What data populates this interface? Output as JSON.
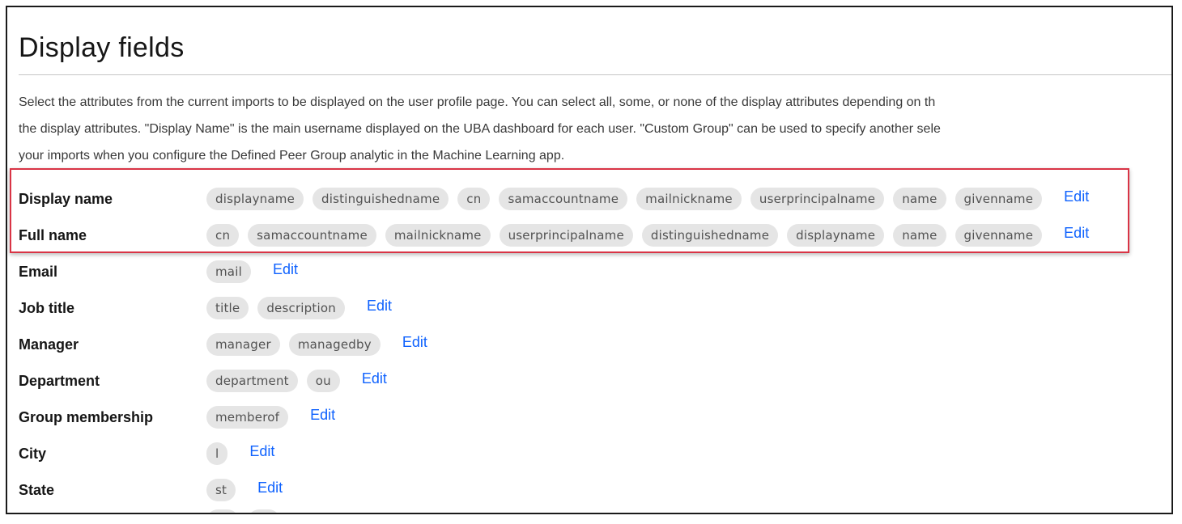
{
  "page": {
    "title": "Display fields",
    "description_lines": [
      "Select the attributes from the current imports to be displayed on the user profile page. You can select all, some, or none of the display attributes depending on th",
      "the display attributes. \"Display Name\" is the main username displayed on the UBA dashboard for each user. \"Custom Group\" can be used to specify another sele",
      "your imports when you configure the Defined Peer Group analytic in the Machine Learning app."
    ]
  },
  "edit_label": "Edit",
  "highlight_color": "#d93445",
  "link_color": "#0f62fe",
  "fields": [
    {
      "label": "Display name",
      "attributes": [
        "displayname",
        "distinguishedname",
        "cn",
        "samaccountname",
        "mailnickname",
        "userprincipalname",
        "name",
        "givenname"
      ]
    },
    {
      "label": "Full name",
      "attributes": [
        "cn",
        "samaccountname",
        "mailnickname",
        "userprincipalname",
        "distinguishedname",
        "displayname",
        "name",
        "givenname"
      ]
    },
    {
      "label": "Email",
      "attributes": [
        "mail"
      ]
    },
    {
      "label": "Job title",
      "attributes": [
        "title",
        "description"
      ]
    },
    {
      "label": "Manager",
      "attributes": [
        "manager",
        "managedby"
      ]
    },
    {
      "label": "Department",
      "attributes": [
        "department",
        "ou"
      ]
    },
    {
      "label": "Group membership",
      "attributes": [
        "memberof"
      ]
    },
    {
      "label": "City",
      "attributes": [
        "l"
      ]
    },
    {
      "label": "State",
      "attributes": [
        "st"
      ]
    }
  ]
}
